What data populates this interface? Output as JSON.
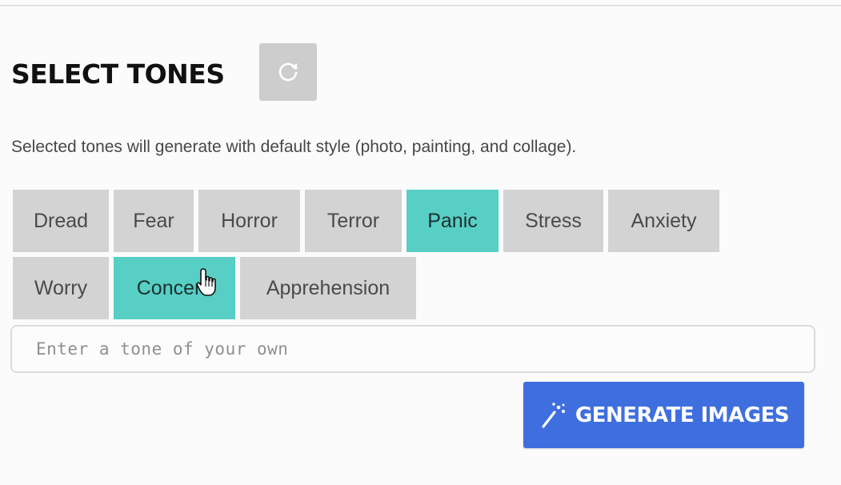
{
  "header": {
    "title": "SELECT TONES",
    "refresh_icon": "refresh-icon"
  },
  "description": "Selected tones will generate with default style (photo, painting, and collage).",
  "tones": [
    {
      "label": "Dread",
      "selected": false
    },
    {
      "label": "Fear",
      "selected": false
    },
    {
      "label": "Horror",
      "selected": false
    },
    {
      "label": "Terror",
      "selected": false
    },
    {
      "label": "Panic",
      "selected": true
    },
    {
      "label": "Stress",
      "selected": false
    },
    {
      "label": "Anxiety",
      "selected": false
    },
    {
      "label": "Worry",
      "selected": false
    },
    {
      "label": "Concern",
      "selected": true
    },
    {
      "label": "Apprehension",
      "selected": false
    }
  ],
  "custom_tone": {
    "placeholder": "Enter a tone of your own",
    "value": ""
  },
  "generate": {
    "label": "GENERATE IMAGES",
    "icon": "magic-wand-icon"
  },
  "colors": {
    "selected_tone": "#57cfc5",
    "unselected_tone": "#d3d3d3",
    "primary_button": "#3f6fdf"
  }
}
